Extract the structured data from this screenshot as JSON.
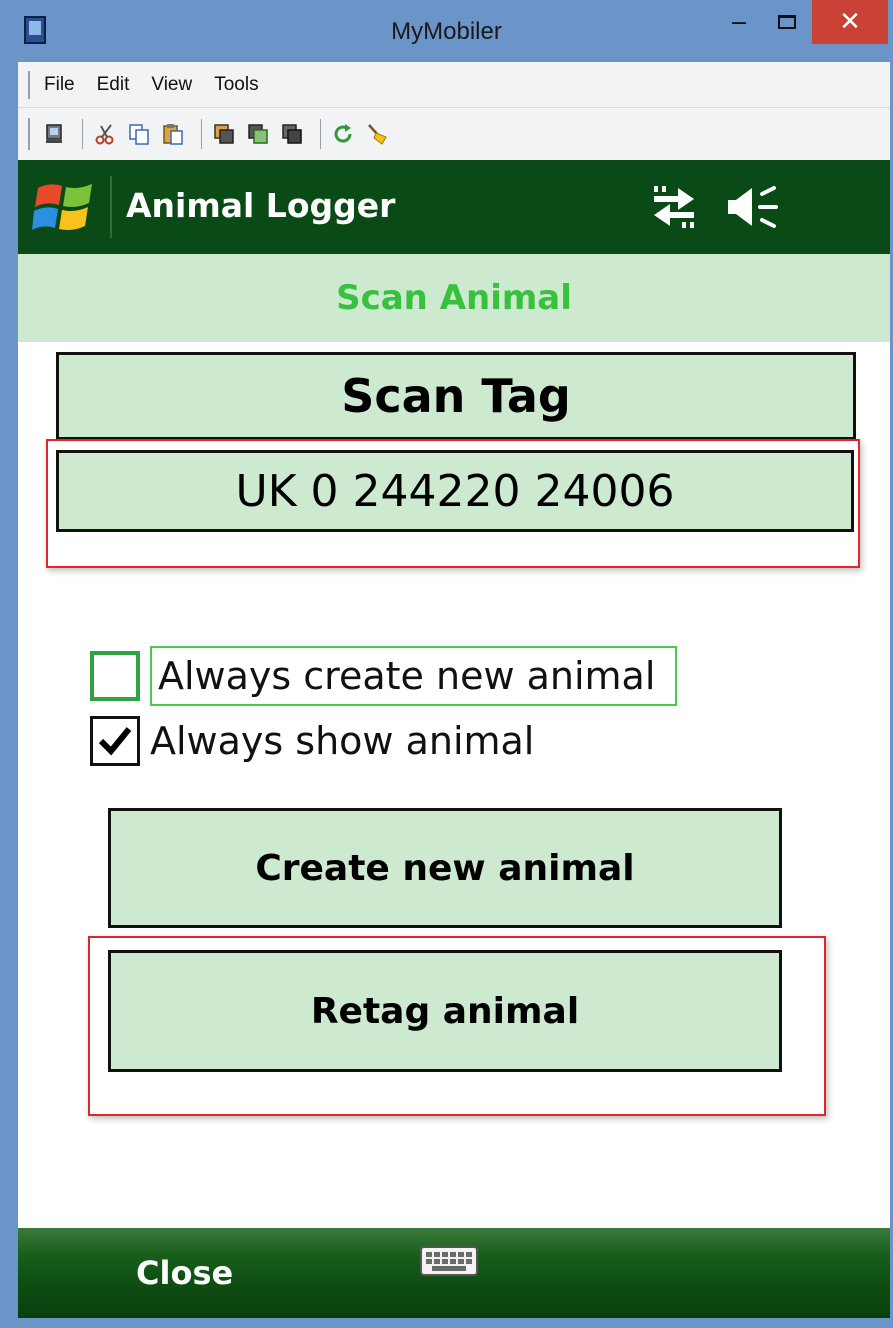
{
  "window": {
    "title": "MyMobiler",
    "minimize_glyph": "‒",
    "close_glyph": "✕"
  },
  "menubar": {
    "items": [
      "File",
      "Edit",
      "View",
      "Tools"
    ]
  },
  "toolbar": {
    "icons": [
      "device-icon",
      "cut-icon",
      "copy-icon",
      "paste-icon",
      "window-copy-icon",
      "window-paste-icon",
      "window-icon",
      "refresh-icon",
      "clean-icon"
    ]
  },
  "app": {
    "header_title": "Animal Logger",
    "screen_title": "Scan Animal",
    "scan_tag_label": "Scan Tag",
    "tag_value": "UK 0 244220 24006",
    "checkboxes": [
      {
        "label": "Always create new animal",
        "checked": false
      },
      {
        "label": "Always show animal",
        "checked": true
      }
    ],
    "create_button_label": "Create new animal",
    "retag_button_label": "Retag animal",
    "close_softkey": "Close"
  },
  "colors": {
    "header_bg": "#0a4a16",
    "subheader_bg": "#cde9cf",
    "subheader_text": "#37c13d",
    "button_bg": "#cde9cf",
    "highlight_red": "#e0262a",
    "highlight_green": "#49cc4e",
    "window_frame": "#6b95c8",
    "close_btn": "#c94135"
  }
}
